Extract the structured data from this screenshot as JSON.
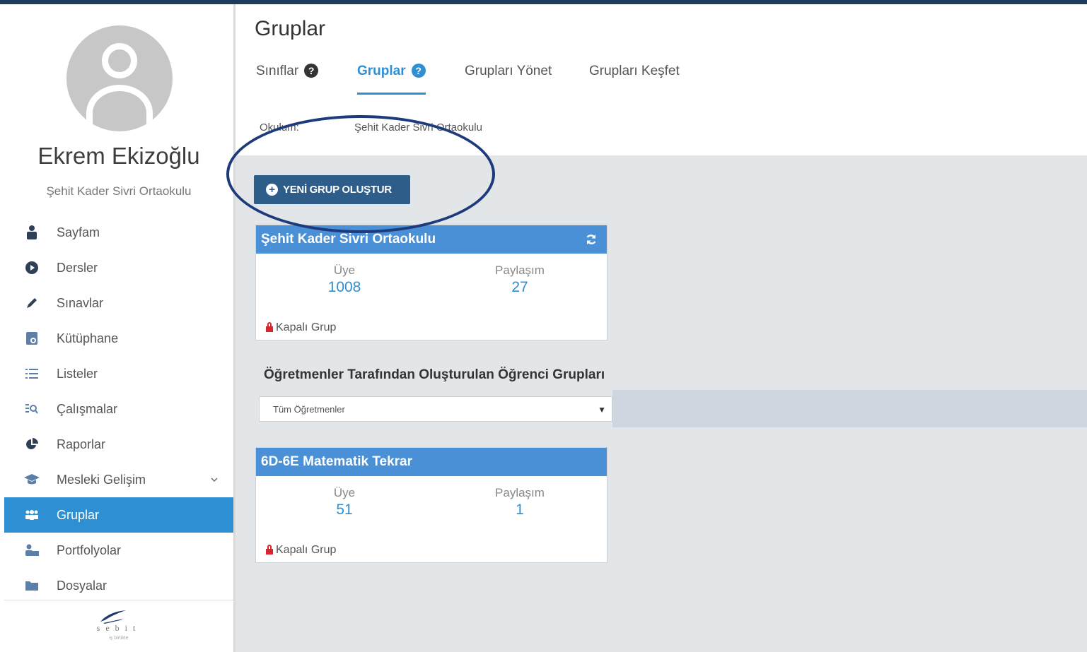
{
  "sidebar": {
    "user_name": "Ekrem Ekizoğlu",
    "school": "Şehit Kader Sivri Ortaokulu",
    "items": [
      {
        "label": "Sayfam",
        "icon": "user-icon"
      },
      {
        "label": "Dersler",
        "icon": "play-circle-icon"
      },
      {
        "label": "Sınavlar",
        "icon": "pencil-icon"
      },
      {
        "label": "Kütüphane",
        "icon": "library-icon"
      },
      {
        "label": "Listeler",
        "icon": "list-icon"
      },
      {
        "label": "Çalışmalar",
        "icon": "search-list-icon"
      },
      {
        "label": "Raporlar",
        "icon": "pie-chart-icon"
      },
      {
        "label": "Mesleki Gelişim",
        "icon": "graduation-cap-icon"
      },
      {
        "label": "Gruplar",
        "icon": "users-icon"
      },
      {
        "label": "Portfolyolar",
        "icon": "user-folder-icon"
      },
      {
        "label": "Dosyalar",
        "icon": "folder-icon"
      }
    ],
    "active_item": "Gruplar",
    "footer": {
      "logo_text": "sebit",
      "tagline": "iş birlikte"
    }
  },
  "page": {
    "title": "Gruplar",
    "tabs": [
      {
        "label": "Sınıflar",
        "help": "?"
      },
      {
        "label": "Gruplar",
        "help": "?"
      },
      {
        "label": "Grupları Yönet"
      },
      {
        "label": "Grupları Keşfet"
      }
    ],
    "active_tab": "Gruplar",
    "okulum_label": "Okulum:",
    "okulum_value": "Şehit Kader Sivri Ortaokulu"
  },
  "new_group_button": {
    "label": "YENİ GRUP OLUŞTUR"
  },
  "school_group": {
    "name": "Şehit Kader Sivri Ortaokulu",
    "member_label": "Üye",
    "member_count": "1008",
    "share_label": "Paylaşım",
    "share_count": "27",
    "status": "Kapalı Grup"
  },
  "teacher_groups": {
    "heading": "Öğretmenler Tarafından Oluşturulan Öğrenci Grupları",
    "filter_value": "Tüm Öğretmenler",
    "groups": [
      {
        "name": "6D-6E Matematik Tekrar",
        "member_label": "Üye",
        "member_count": "51",
        "share_label": "Paylaşım",
        "share_count": "1",
        "status": "Kapalı Grup"
      }
    ]
  },
  "colors": {
    "accent": "#2f8fd3",
    "button": "#2e5d8a",
    "card_header": "#4a90d6",
    "content_bg": "#e3e6e9",
    "annotation": "#1d3a7c"
  }
}
